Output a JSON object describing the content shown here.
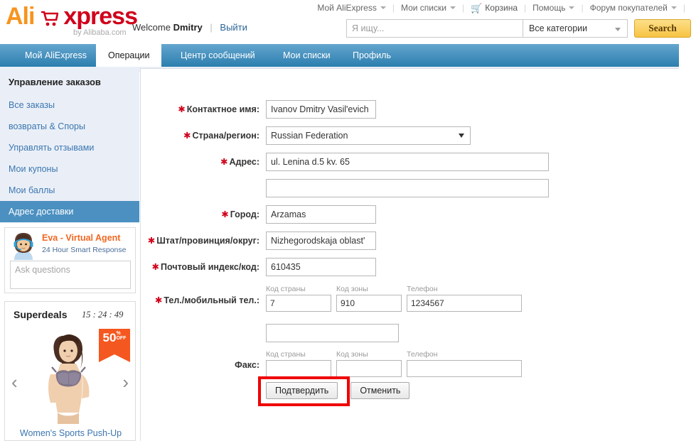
{
  "brand": {
    "logo_ali": "Ali",
    "logo_xpress": "xpress",
    "byline": "by Alibaba.com",
    "cart_icon": "shopping-cart-icon",
    "accent_orange": "#f7941e",
    "accent_red": "#d0021b"
  },
  "top_nav": {
    "items": [
      {
        "label": "Мой AliExpress",
        "has_caret": true,
        "icon": ""
      },
      {
        "label": "Мои списки",
        "has_caret": true,
        "icon": ""
      },
      {
        "label": "Корзина",
        "has_caret": false,
        "icon": "cart-icon"
      },
      {
        "label": "Помощь",
        "has_caret": true,
        "icon": ""
      },
      {
        "label": "Форум покупателей",
        "has_caret": true,
        "icon": ""
      }
    ]
  },
  "welcome": {
    "greeting": "Welcome",
    "username": "Dmitry",
    "logout_label": "Выйти"
  },
  "search": {
    "placeholder": "Я ищу...",
    "value": "",
    "category_selected": "Все категории",
    "button_label": "Search"
  },
  "tabs": [
    {
      "label": "Мой AliExpress",
      "active": false
    },
    {
      "label": "Операции",
      "active": true
    },
    {
      "label": "Центр сообщений",
      "active": false
    },
    {
      "label": "Мои списки",
      "active": false
    },
    {
      "label": "Профиль",
      "active": false
    }
  ],
  "sidebar": {
    "title": "Управление заказов",
    "items": [
      {
        "label": "Все заказы",
        "selected": false
      },
      {
        "label": "возвраты & Споры",
        "selected": false
      },
      {
        "label": "Управлять отзывами",
        "selected": false
      },
      {
        "label": "Мои купоны",
        "selected": false
      },
      {
        "label": "Мои баллы",
        "selected": false
      },
      {
        "label": "Адрес доставки",
        "selected": true
      }
    ],
    "selected_bg": "#4b90c0"
  },
  "eva": {
    "title": "Eva - Virtual Agent",
    "subtitle": "24 Hour Smart Response",
    "input_placeholder": "Ask questions",
    "input_value": "",
    "avatar_icon": "agent-avatar-icon"
  },
  "superdeals": {
    "title": "Superdeals",
    "timer": "15 : 24 : 49",
    "badge_number": "50",
    "badge_off": "%\nOFF",
    "badge_num": "50",
    "badge_pct": "%",
    "badge_label": "OFF",
    "prev_icon": "chevron-left-icon",
    "next_icon": "chevron-right-icon",
    "caption": "Women's Sports Push-Up",
    "badge_color": "#f4571f"
  },
  "form": {
    "fields": [
      {
        "name": "contact-name",
        "label": "Контактное имя:",
        "required": true,
        "type": "text",
        "value": "Ivanov Dmitry Vasil'evich"
      },
      {
        "name": "country-region",
        "label": "Страна/регион:",
        "required": true,
        "type": "select",
        "value": "Russian Federation"
      },
      {
        "name": "address-line-1",
        "label": "Адрес:",
        "required": true,
        "type": "text-wide",
        "value": "ul. Lenina d.5 kv. 65",
        "has_cursor": true
      },
      {
        "name": "address-line-2",
        "label": "",
        "required": false,
        "type": "text-wide",
        "value": ""
      },
      {
        "name": "city",
        "label": "Город:",
        "required": true,
        "type": "text",
        "value": "Arzamas"
      },
      {
        "name": "state-province",
        "label": "Штат/провинция/округ:",
        "required": true,
        "type": "text",
        "value": "Nizhegorodskaja oblast'"
      },
      {
        "name": "zip-code",
        "label": "Почтовый индекс/код:",
        "required": true,
        "type": "text",
        "value": "610435"
      }
    ],
    "phone": {
      "label": "Тел./мобильный тел.:",
      "required": true,
      "country_code_label": "Код страны",
      "area_code_label": "Код зоны",
      "number_label": "Телефон",
      "country_code": "7",
      "area_code": "910",
      "number": "1234567",
      "extra_value": ""
    },
    "fax": {
      "label": "Факс:",
      "required": false,
      "country_code_label": "Код страны",
      "area_code_label": "Код зоны",
      "number_label": "Телефон",
      "country_code": "",
      "area_code": "",
      "number": ""
    },
    "submit_label": "Подтвердить",
    "cancel_label": "Отменить",
    "highlight_color": "#ef0000"
  }
}
